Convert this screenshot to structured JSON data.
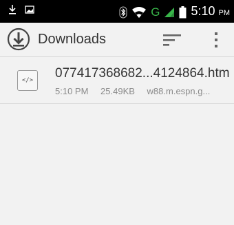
{
  "status_bar": {
    "time": "5:10",
    "ampm": "PM",
    "network": "G"
  },
  "action_bar": {
    "title": "Downloads"
  },
  "downloads": [
    {
      "icon_label": "</>",
      "file_name": "077417368682...4124864.htm",
      "time": "5:10 PM",
      "size": "25.49KB",
      "source": "w88.m.espn.g..."
    }
  ],
  "colors": {
    "status_bar_bg": "#000000",
    "background": "#f2f2f2",
    "signal_green": "#39b54a",
    "text_primary": "#333333",
    "text_secondary": "#8a8a8a"
  }
}
